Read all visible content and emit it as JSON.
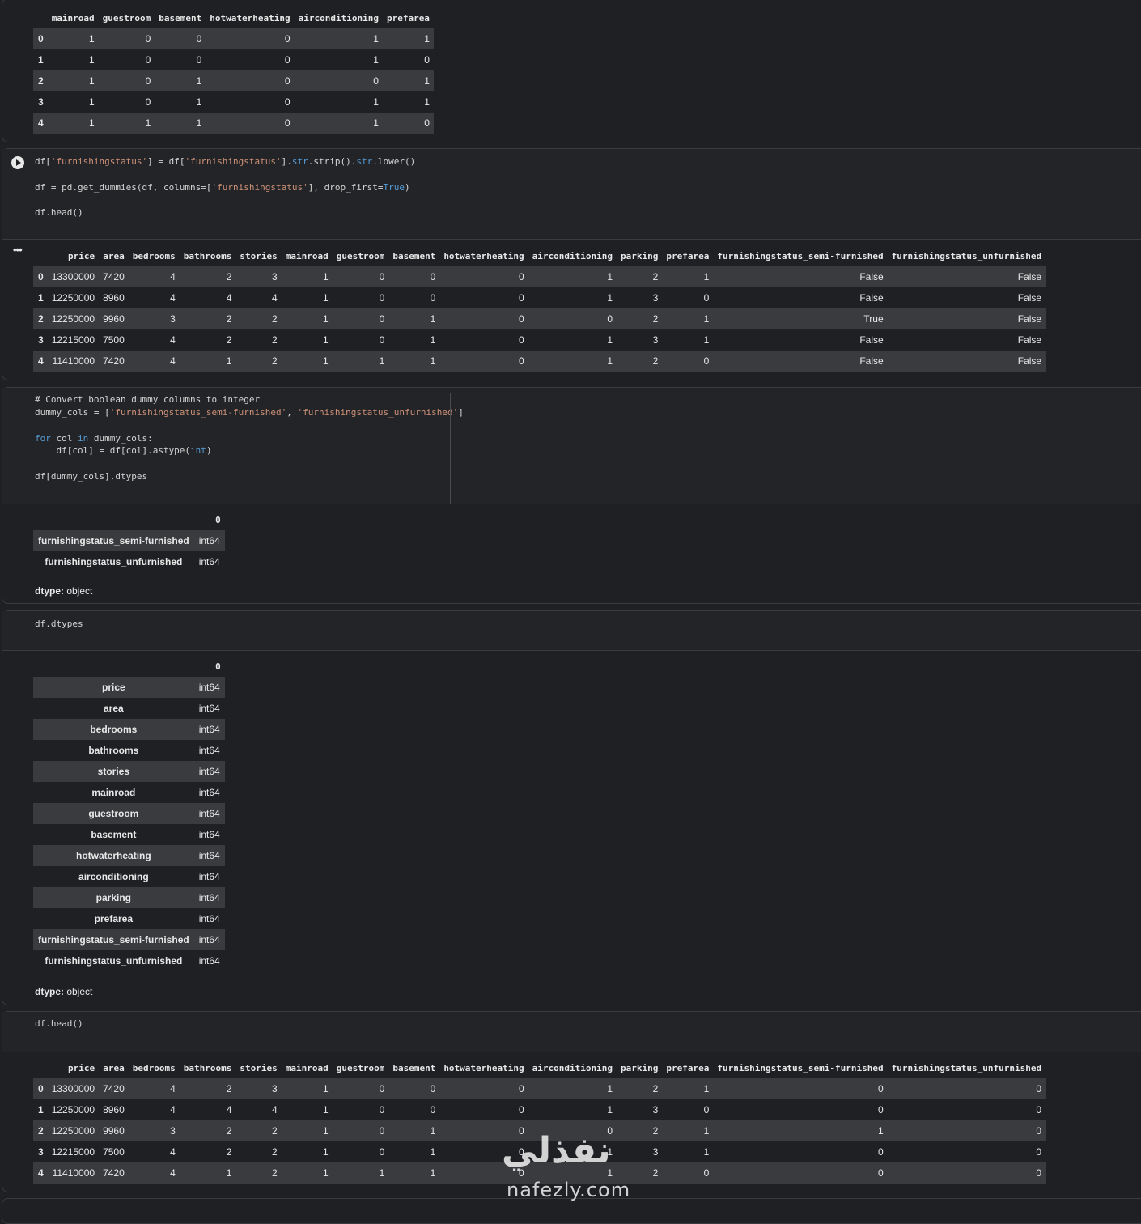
{
  "table1": {
    "columns": [
      "",
      "mainroad",
      "guestroom",
      "basement",
      "hotwaterheating",
      "airconditioning",
      "prefarea"
    ],
    "rows": [
      [
        "0",
        "1",
        "0",
        "0",
        "0",
        "1",
        "1"
      ],
      [
        "1",
        "1",
        "0",
        "0",
        "0",
        "1",
        "0"
      ],
      [
        "2",
        "1",
        "0",
        "1",
        "0",
        "0",
        "1"
      ],
      [
        "3",
        "1",
        "0",
        "1",
        "0",
        "1",
        "1"
      ],
      [
        "4",
        "1",
        "1",
        "1",
        "0",
        "1",
        "0"
      ]
    ]
  },
  "cell2": {
    "line1_a": "df[",
    "line1_b": "'furnishingstatus'",
    "line1_c": "] = df[",
    "line1_d": "'furnishingstatus'",
    "line1_e": "].",
    "line1_f": "str",
    "line1_g": ".strip().",
    "line1_h": "str",
    "line1_i": ".lower()",
    "line2_a": "df = pd.get_dummies(df, columns=[",
    "line2_b": "'furnishingstatus'",
    "line2_c": "], drop_first=",
    "line2_d": "True",
    "line2_e": ")",
    "line3": "df.head()",
    "more": "•••"
  },
  "table2": {
    "columns": [
      "",
      "price",
      "area",
      "bedrooms",
      "bathrooms",
      "stories",
      "mainroad",
      "guestroom",
      "basement",
      "hotwaterheating",
      "airconditioning",
      "parking",
      "prefarea",
      "furnishingstatus_semi-furnished",
      "furnishingstatus_unfurnished"
    ],
    "rows": [
      [
        "0",
        "13300000",
        "7420",
        "4",
        "2",
        "3",
        "1",
        "0",
        "0",
        "0",
        "1",
        "2",
        "1",
        "False",
        "False"
      ],
      [
        "1",
        "12250000",
        "8960",
        "4",
        "4",
        "4",
        "1",
        "0",
        "0",
        "0",
        "1",
        "3",
        "0",
        "False",
        "False"
      ],
      [
        "2",
        "12250000",
        "9960",
        "3",
        "2",
        "2",
        "1",
        "0",
        "1",
        "0",
        "0",
        "2",
        "1",
        "True",
        "False"
      ],
      [
        "3",
        "12215000",
        "7500",
        "4",
        "2",
        "2",
        "1",
        "0",
        "1",
        "0",
        "1",
        "3",
        "1",
        "False",
        "False"
      ],
      [
        "4",
        "11410000",
        "7420",
        "4",
        "1",
        "2",
        "1",
        "1",
        "1",
        "0",
        "1",
        "2",
        "0",
        "False",
        "False"
      ]
    ]
  },
  "cell3": {
    "comment": "# Convert boolean dummy columns to integer",
    "l2_a": "dummy_cols = [",
    "l2_b": "'furnishingstatus_semi-furnished'",
    "l2_c": ", ",
    "l2_d": "'furnishingstatus_unfurnished'",
    "l2_e": "]",
    "l3_a": "for",
    "l3_b": " col ",
    "l3_c": "in",
    "l3_d": " dummy_cols:",
    "l4_a": "    df[col] = df[col].astype(",
    "l4_b": "int",
    "l4_c": ")",
    "l5": "df[dummy_cols].dtypes"
  },
  "series1": {
    "header": "0",
    "rows": [
      [
        "furnishingstatus_semi-furnished",
        "int64"
      ],
      [
        "furnishingstatus_unfurnished",
        "int64"
      ]
    ],
    "dtype_label": "dtype:",
    "dtype_value": " object"
  },
  "cell4": {
    "code": "df.dtypes"
  },
  "series2": {
    "header": "0",
    "rows": [
      [
        "price",
        "int64"
      ],
      [
        "area",
        "int64"
      ],
      [
        "bedrooms",
        "int64"
      ],
      [
        "bathrooms",
        "int64"
      ],
      [
        "stories",
        "int64"
      ],
      [
        "mainroad",
        "int64"
      ],
      [
        "guestroom",
        "int64"
      ],
      [
        "basement",
        "int64"
      ],
      [
        "hotwaterheating",
        "int64"
      ],
      [
        "airconditioning",
        "int64"
      ],
      [
        "parking",
        "int64"
      ],
      [
        "prefarea",
        "int64"
      ],
      [
        "furnishingstatus_semi-furnished",
        "int64"
      ],
      [
        "furnishingstatus_unfurnished",
        "int64"
      ]
    ],
    "dtype_label": "dtype:",
    "dtype_value": " object"
  },
  "cell5": {
    "code": "df.head()"
  },
  "table3": {
    "columns": [
      "",
      "price",
      "area",
      "bedrooms",
      "bathrooms",
      "stories",
      "mainroad",
      "guestroom",
      "basement",
      "hotwaterheating",
      "airconditioning",
      "parking",
      "prefarea",
      "furnishingstatus_semi-furnished",
      "furnishingstatus_unfurnished"
    ],
    "rows": [
      [
        "0",
        "13300000",
        "7420",
        "4",
        "2",
        "3",
        "1",
        "0",
        "0",
        "0",
        "1",
        "2",
        "1",
        "0",
        "0"
      ],
      [
        "1",
        "12250000",
        "8960",
        "4",
        "4",
        "4",
        "1",
        "0",
        "0",
        "0",
        "1",
        "3",
        "0",
        "0",
        "0"
      ],
      [
        "2",
        "12250000",
        "9960",
        "3",
        "2",
        "2",
        "1",
        "0",
        "1",
        "0",
        "0",
        "2",
        "1",
        "1",
        "0"
      ],
      [
        "3",
        "12215000",
        "7500",
        "4",
        "2",
        "2",
        "1",
        "0",
        "1",
        "0",
        "1",
        "3",
        "1",
        "0",
        "0"
      ],
      [
        "4",
        "11410000",
        "7420",
        "4",
        "1",
        "2",
        "1",
        "1",
        "1",
        "0",
        "1",
        "2",
        "0",
        "0",
        "0"
      ]
    ]
  },
  "watermark": {
    "arabic": "نفذلي",
    "latin": "nafezly.com"
  }
}
